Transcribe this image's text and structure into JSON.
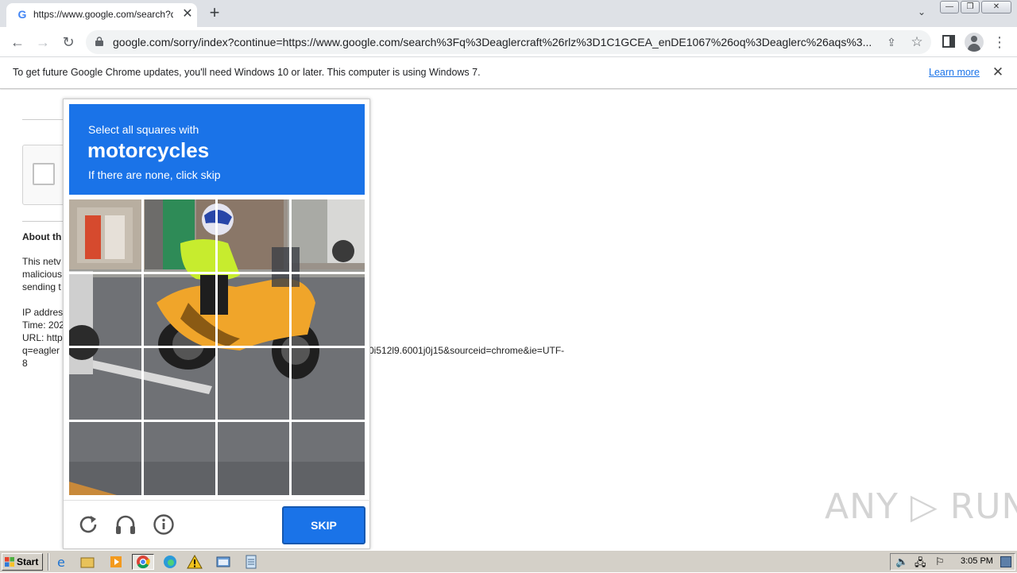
{
  "browser": {
    "tab_title": "https://www.google.com/search?q=eaglercraft",
    "tab_close": "✕",
    "new_tab": "+",
    "url": "google.com/sorry/index?continue=https://www.google.com/search%3Fq%3Deaglercraft%26rlz%3D1C1GCEA_enDE1067%26oq%3Deaglerc%26aqs%3..."
  },
  "infobar": {
    "message": "To get future Google Chrome updates, you'll need Windows 10 or later. This computer is using Windows 7.",
    "link": "Learn more",
    "close": "✕"
  },
  "page": {
    "about_heading": "About th",
    "para_lines": [
      "This netv",
      "malicious",
      "sending t"
    ],
    "ip_line": "IP addres",
    "time_line": "Time: 202",
    "url_line": "URL: http",
    "q_line_left": "q=eagler",
    "q_line_right": "0i512l9.6001j0j15&sourceid=chrome&ie=UTF-",
    "q_line_end": "8"
  },
  "captcha": {
    "instruction_pre": "Select all squares with",
    "target": "motorcycles",
    "instruction_sub": "If there are none, click skip",
    "skip_label": "SKIP",
    "header_color": "#1a73e8"
  },
  "watermark": "ANY ▷ RUN",
  "taskbar": {
    "start_label": "Start",
    "clock": "3:05 PM"
  }
}
